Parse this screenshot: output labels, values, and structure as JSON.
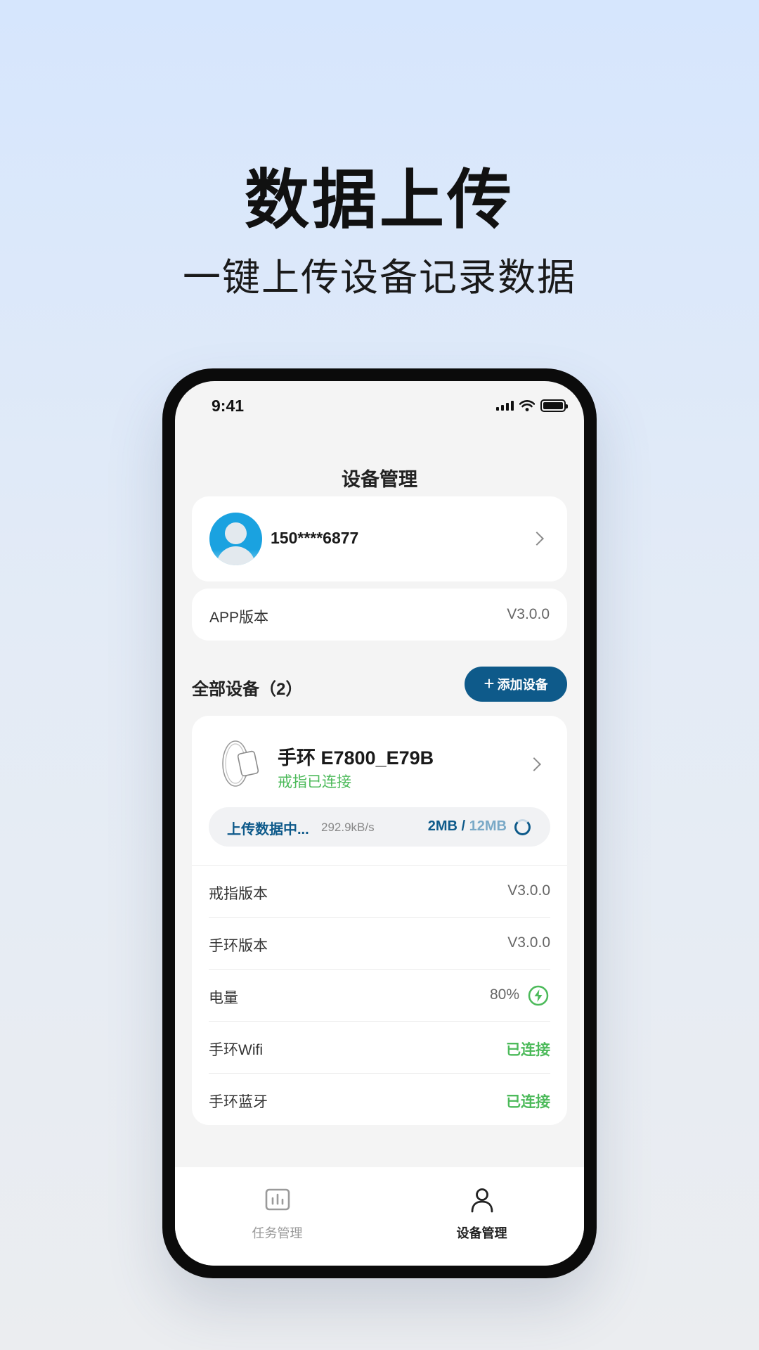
{
  "hero": {
    "title": "数据上传",
    "subtitle": "一键上传设备记录数据"
  },
  "status_bar": {
    "time": "9:41"
  },
  "header": {
    "title": "设备管理"
  },
  "user": {
    "phone": "150****6877"
  },
  "app_version": {
    "label": "APP版本",
    "value": "V3.0.0"
  },
  "devices_section": {
    "title": "全部设备（2）",
    "add_button": "添加设备"
  },
  "device": {
    "name": "手环 E7800_E79B",
    "status": "戒指已连接",
    "upload": {
      "label": "上传数据中...",
      "speed": "292.9kB/s",
      "done": "2MB",
      "separator": "/",
      "total": "12MB"
    },
    "info": [
      {
        "label": "戒指版本",
        "value": "V3.0.0"
      },
      {
        "label": "手环版本",
        "value": "V3.0.0"
      },
      {
        "label": "电量",
        "value": "80%"
      },
      {
        "label": "手环Wifi",
        "value": "已连接"
      },
      {
        "label": "手环蓝牙",
        "value": "已连接"
      }
    ]
  },
  "tabs": [
    {
      "label": "任务管理",
      "icon": "chart-icon",
      "active": false
    },
    {
      "label": "设备管理",
      "icon": "user-icon",
      "active": true
    }
  ],
  "colors": {
    "accent": "#0e5a8a",
    "success": "#4cba5a"
  }
}
